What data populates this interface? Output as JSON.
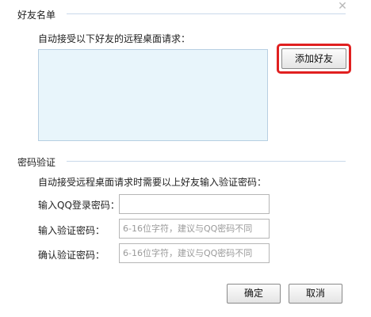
{
  "friend_list": {
    "section_title": "好友名单",
    "description": "自动接受以下好友的远程桌面请求：",
    "add_button": "添加好友"
  },
  "password_verify": {
    "section_title": "密码验证",
    "description": "自动接受远程桌面请求时需要以上好友输入验证密码：",
    "qq_login_label": "输入QQ登录密码：",
    "qq_login_value": "",
    "verify_label": "输入验证密码：",
    "verify_placeholder": "6-16位字符，建议与QQ密码不同",
    "confirm_label": "确认验证密码：",
    "confirm_placeholder": "6-16位字符，建议与QQ密码不同"
  },
  "footer": {
    "ok_button": "确定",
    "cancel_button": "取消"
  },
  "colors": {
    "highlight": "#e02020",
    "list_background": "#e8f5fb",
    "divider": "#c9d9ea"
  }
}
